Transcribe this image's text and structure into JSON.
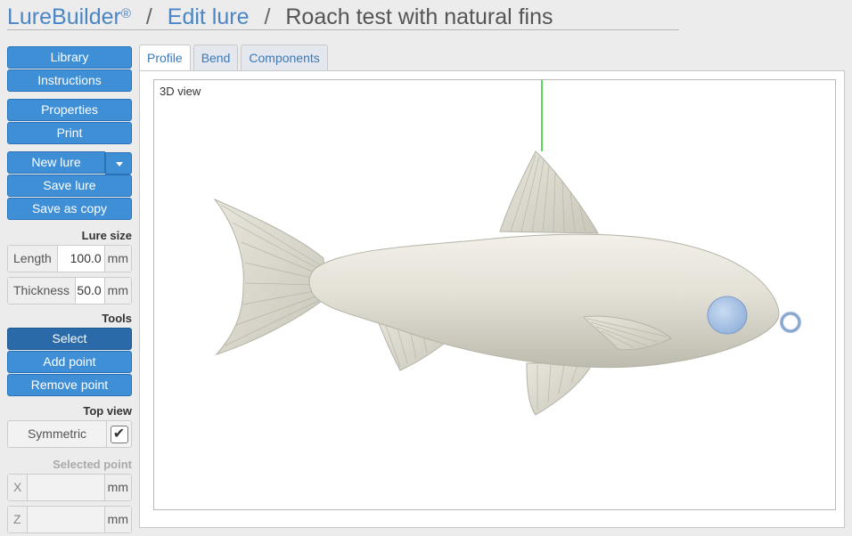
{
  "header": {
    "brand": "LureBuilder",
    "brand_mark": "®",
    "separator": "/",
    "crumb_link": "Edit lure",
    "crumb_current": "Roach test with natural fins"
  },
  "sidebar": {
    "library": "Library",
    "instructions": "Instructions",
    "properties": "Properties",
    "print": "Print",
    "new_lure": "New lure",
    "save_lure": "Save lure",
    "save_as_copy": "Save as copy",
    "lure_size_label": "Lure size",
    "length_label": "Length",
    "length_value": "100.0",
    "thickness_label": "Thickness",
    "thickness_value": "50.0",
    "unit": "mm",
    "tools_label": "Tools",
    "select": "Select",
    "add_point": "Add point",
    "remove_point": "Remove point",
    "top_view_label": "Top view",
    "symmetric_label": "Symmetric",
    "symmetric_checked": "✔",
    "selected_point_label": "Selected point",
    "x_label": "X",
    "z_label": "Z"
  },
  "tabs": [
    "Profile",
    "Bend",
    "Components"
  ],
  "viewport": {
    "label": "3D view",
    "axis_color": "#22cc22",
    "body_color": "#e3e1d6",
    "eye_color": "#a9c4e6"
  }
}
